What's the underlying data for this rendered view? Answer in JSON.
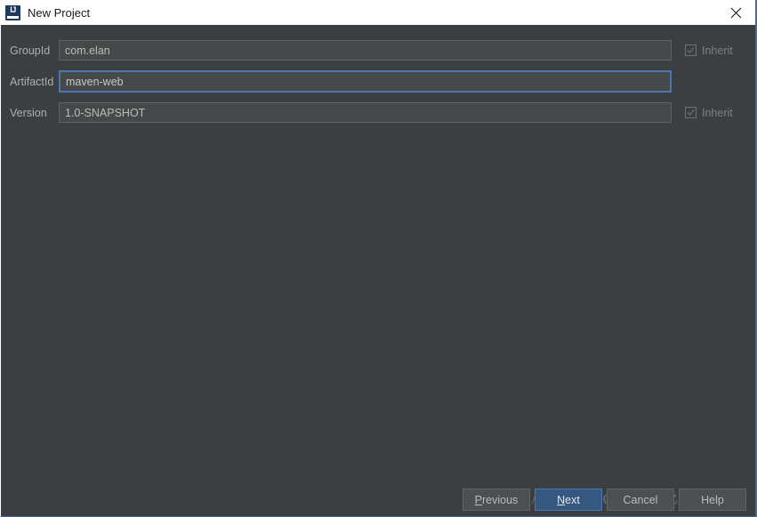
{
  "window": {
    "title": "New Project",
    "app_icon": "intellij-idea-icon",
    "close_icon": "close-icon",
    "border_accent_color": "#3c6ba5",
    "background_color": "#3c3f41"
  },
  "form": {
    "fields": [
      {
        "label": "GroupId",
        "value": "com.elan",
        "focused": false,
        "inherit": {
          "label": "Inherit",
          "checked": true,
          "disabled": true
        }
      },
      {
        "label": "ArtifactId",
        "value": "maven-web",
        "focused": true,
        "inherit": null
      },
      {
        "label": "Version",
        "value": "1.0-SNAPSHOT",
        "focused": false,
        "inherit": {
          "label": "Inherit",
          "checked": true,
          "disabled": true
        }
      }
    ]
  },
  "footer": {
    "buttons": [
      {
        "label": "Previous",
        "mnemonic": "P",
        "primary": false
      },
      {
        "label": "Next",
        "mnemonic": "N",
        "primary": true
      },
      {
        "label": "Cancel",
        "mnemonic": "",
        "primary": false
      },
      {
        "label": "Help",
        "mnemonic": "",
        "primary": false
      }
    ]
  },
  "watermark": {
    "text": "https://blog.csdn.net/czc9309"
  }
}
